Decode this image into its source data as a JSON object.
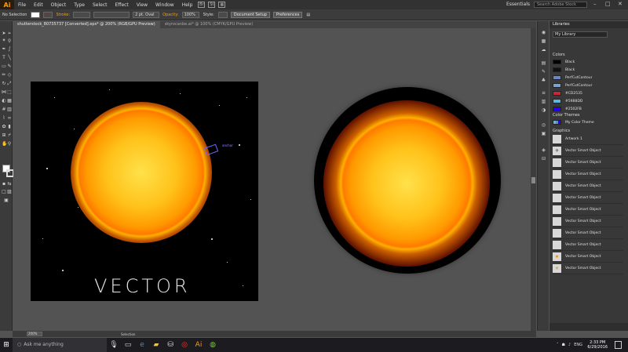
{
  "app": {
    "logo": "Ai"
  },
  "menu": [
    "File",
    "Edit",
    "Object",
    "Type",
    "Select",
    "Effect",
    "View",
    "Window",
    "Help"
  ],
  "menu_icons": [
    {
      "name": "bridge-icon",
      "glyph": "Br"
    },
    {
      "name": "stock-icon",
      "glyph": "St"
    },
    {
      "name": "arrange-icon",
      "glyph": "▦"
    }
  ],
  "workspace": "Essentials",
  "stock_search_placeholder": "Search Adobe Stock",
  "window_controls": [
    "–",
    "□",
    "✕"
  ],
  "control_bar": {
    "selection": "No Selection",
    "stroke_label": "Stroke:",
    "stroke_profile": "2 pt. Oval",
    "opacity_label": "Opacity:",
    "opacity_value": "100%",
    "style_label": "Style:",
    "document_setup": "Document Setup",
    "preferences": "Preferences"
  },
  "tabs": [
    {
      "label": "shutterstock_80735737 [Converted].eps* @ 200% (RGB/GPU Preview)",
      "active": true
    },
    {
      "label": "skyrocanbe.ai* @ 100% (CMYK/GPU Preview)",
      "active": false
    }
  ],
  "artboard": {
    "text": "VECTOR",
    "anchor_label": "anchor"
  },
  "status": {
    "zoom": "200%",
    "tool": "Selection"
  },
  "libraries": {
    "panel_title": "Libraries",
    "library_name": "My Library",
    "colors_heading": "Colors",
    "colors": [
      {
        "name": "Black",
        "hex": "#000000"
      },
      {
        "name": "Black",
        "hex": "#111111"
      },
      {
        "name": "PerfCutContour",
        "hex": "#6b86c4"
      },
      {
        "name": "PerfCutContour",
        "hex": "#7ea0d0"
      },
      {
        "name": "#CD2535",
        "hex": "#cd2535"
      },
      {
        "name": "#59B8DD",
        "hex": "#59b8dd"
      },
      {
        "name": "#2502FB",
        "hex": "#2502fb"
      }
    ],
    "color_themes_heading": "Color Themes",
    "color_theme": "My Color Theme",
    "graphics_heading": "Graphics",
    "graphics": [
      "Artwork 1",
      "Vector Smart Object",
      "Vector Smart Object",
      "Vector Smart Object",
      "Vector Smart Object",
      "Vector Smart Object",
      "Vector Smart Object",
      "Vector Smart Object",
      "Vector Smart Object",
      "Vector Smart Object",
      "Vector Smart Object",
      "Vector Smart Object"
    ]
  },
  "taskbar": {
    "search_placeholder": "Ask me anything",
    "language": "ENG",
    "time": "2:33 PM",
    "date": "6/29/2016"
  }
}
